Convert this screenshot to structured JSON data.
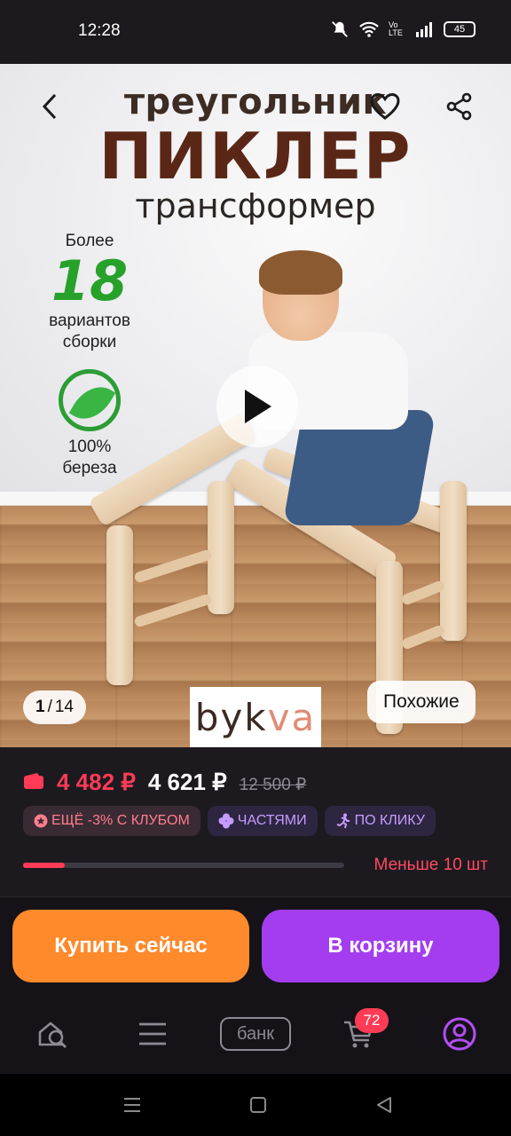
{
  "status_bar": {
    "time": "12:28",
    "battery": "45",
    "network": "Vo LTE"
  },
  "hero": {
    "headline_line1": "треугольник",
    "headline_line2": "ПИКЛЕР",
    "headline_line3": "трансформер",
    "promo_more": "Более",
    "promo_number": "18",
    "promo_variants": "вариантов сборки",
    "promo_percent": "100%",
    "promo_material": "береза",
    "counter_current": "1",
    "counter_separator": "/",
    "counter_total": "14",
    "brand_logo_part1": "byk",
    "brand_logo_part2": "va",
    "similar_label": "Похожие"
  },
  "product": {
    "price_wallet": "4 482 ₽",
    "price_regular": "4 621 ₽",
    "price_old": "12 500 ₽",
    "chips": [
      "ЕЩЁ -3% С КЛУБОМ",
      "ЧАСТЯМИ",
      "ПО КЛИКУ"
    ],
    "stock_fraction": 0.13,
    "stock_text": "Меньше 10 шт"
  },
  "actions": {
    "buy_now": "Купить сейчас",
    "add_to_cart": "В корзину"
  },
  "tabbar": {
    "bank_label": "банк",
    "cart_badge": "72"
  },
  "colors": {
    "price_red": "#ff3b55",
    "buy_orange": "#ff8a2b",
    "cart_purple": "#a43df0",
    "background": "#1c1a1f"
  }
}
